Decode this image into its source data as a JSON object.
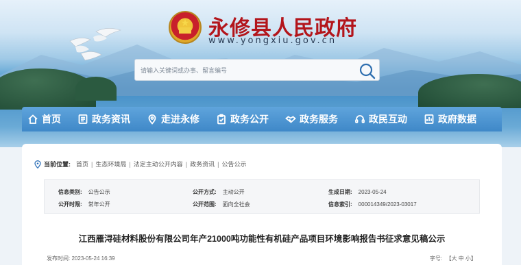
{
  "header": {
    "site_title": "永修县人民政府",
    "site_url": "www.yongxiu.gov.cn"
  },
  "search": {
    "placeholder": "请输入关键词或办事、留言编号"
  },
  "nav": {
    "items": [
      {
        "label": "首页",
        "icon": "home-icon"
      },
      {
        "label": "政务资讯",
        "icon": "news-icon"
      },
      {
        "label": "走进永修",
        "icon": "location-icon"
      },
      {
        "label": "政务公开",
        "icon": "clipboard-icon"
      },
      {
        "label": "政务服务",
        "icon": "handshake-icon"
      },
      {
        "label": "政民互动",
        "icon": "headset-icon"
      },
      {
        "label": "政府数据",
        "icon": "data-icon"
      }
    ]
  },
  "breadcrumb": {
    "label": "当前位置:",
    "items": [
      "首页",
      "生态环境局",
      "法定主动公开内容",
      "政务资讯",
      "公告公示"
    ]
  },
  "info": {
    "category_label": "信息类别:",
    "category_value": "公告公示",
    "public_method_label": "公开方式:",
    "public_method_value": "主动公开",
    "generated_date_label": "生成日期:",
    "generated_date_value": "2023-05-24",
    "public_period_label": "公开时限:",
    "public_period_value": "常年公开",
    "public_scope_label": "公开范围:",
    "public_scope_value": "面向全社会",
    "index_label": "信息索引:",
    "index_value": "000014349/2023-03017"
  },
  "article": {
    "title": "江西雁浔硅材料股份有限公司年产21000吨功能性有机硅产品项目环境影响报告书征求意见稿公示",
    "publish_label": "发布时间:",
    "publish_time": "2023-05-24 16:39",
    "font_size_label": "字号:",
    "font_size_options": "【大 中 小】"
  }
}
